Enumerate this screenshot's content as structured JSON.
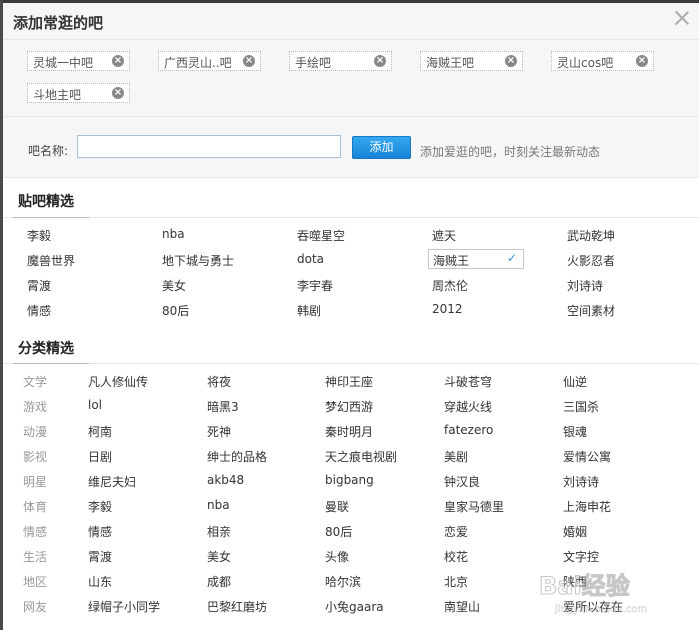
{
  "dialog": {
    "title": "添加常逛的吧"
  },
  "tags": [
    {
      "label": "灵城一中吧"
    },
    {
      "label": "广西灵山..吧"
    },
    {
      "label": "手绘吧"
    },
    {
      "label": "海贼王吧"
    },
    {
      "label": "灵山cos吧"
    },
    {
      "label": "斗地主吧"
    }
  ],
  "name_row": {
    "label": "吧名称:",
    "input_value": "",
    "input_placeholder": "",
    "add_label": "添加",
    "hint": "添加爱逛的吧，时刻关注最新动态"
  },
  "featured": {
    "title": "贴吧精选",
    "rows": [
      [
        "李毅",
        "nba",
        "吞噬星空",
        "遮天",
        "武动乾坤"
      ],
      [
        "魔兽世界",
        "地下城与勇士",
        "dota",
        "海贼王",
        "火影忍者"
      ],
      [
        "霄渡",
        "美女",
        "李宇春",
        "周杰伦",
        "刘诗诗"
      ],
      [
        "情感",
        "80后",
        "韩剧",
        "2012",
        "空间素材"
      ]
    ],
    "selected": "海贼王"
  },
  "categories": {
    "title": "分类精选",
    "rows": [
      {
        "label": "文学",
        "items": [
          "凡人修仙传",
          "将夜",
          "神印王座",
          "斗破苍穹",
          "仙逆"
        ]
      },
      {
        "label": "游戏",
        "items": [
          "lol",
          "暗黑3",
          "梦幻西游",
          "穿越火线",
          "三国杀"
        ]
      },
      {
        "label": "动漫",
        "items": [
          "柯南",
          "死神",
          "秦时明月",
          "fatezero",
          "银魂"
        ]
      },
      {
        "label": "影视",
        "items": [
          "日剧",
          "绅士的品格",
          "天之痕电视剧",
          "美剧",
          "爱情公寓"
        ]
      },
      {
        "label": "明星",
        "items": [
          "维尼夫妇",
          "akb48",
          "bigbang",
          "钟汉良",
          "刘诗诗"
        ]
      },
      {
        "label": "体育",
        "items": [
          "李毅",
          "nba",
          "曼联",
          "皇家马德里",
          "上海申花"
        ]
      },
      {
        "label": "情感",
        "items": [
          "情感",
          "相亲",
          "80后",
          "恋爱",
          "婚姻"
        ]
      },
      {
        "label": "生活",
        "items": [
          "霄渡",
          "美女",
          "头像",
          "校花",
          "文字控"
        ]
      },
      {
        "label": "地区",
        "items": [
          "山东",
          "成都",
          "哈尔滨",
          "北京",
          "陕西"
        ]
      },
      {
        "label": "网友",
        "items": [
          "绿帽子小同学",
          "巴黎红磨坊",
          "小兔gaara",
          "南望山",
          "爱所以存在"
        ]
      }
    ]
  },
  "watermark": {
    "text": "Bai经验",
    "sub": "jingyan.baidu.com"
  },
  "colors": {
    "accent": "#1783d6",
    "check": "#3a8ed6",
    "panel": "#f6f6f6"
  }
}
